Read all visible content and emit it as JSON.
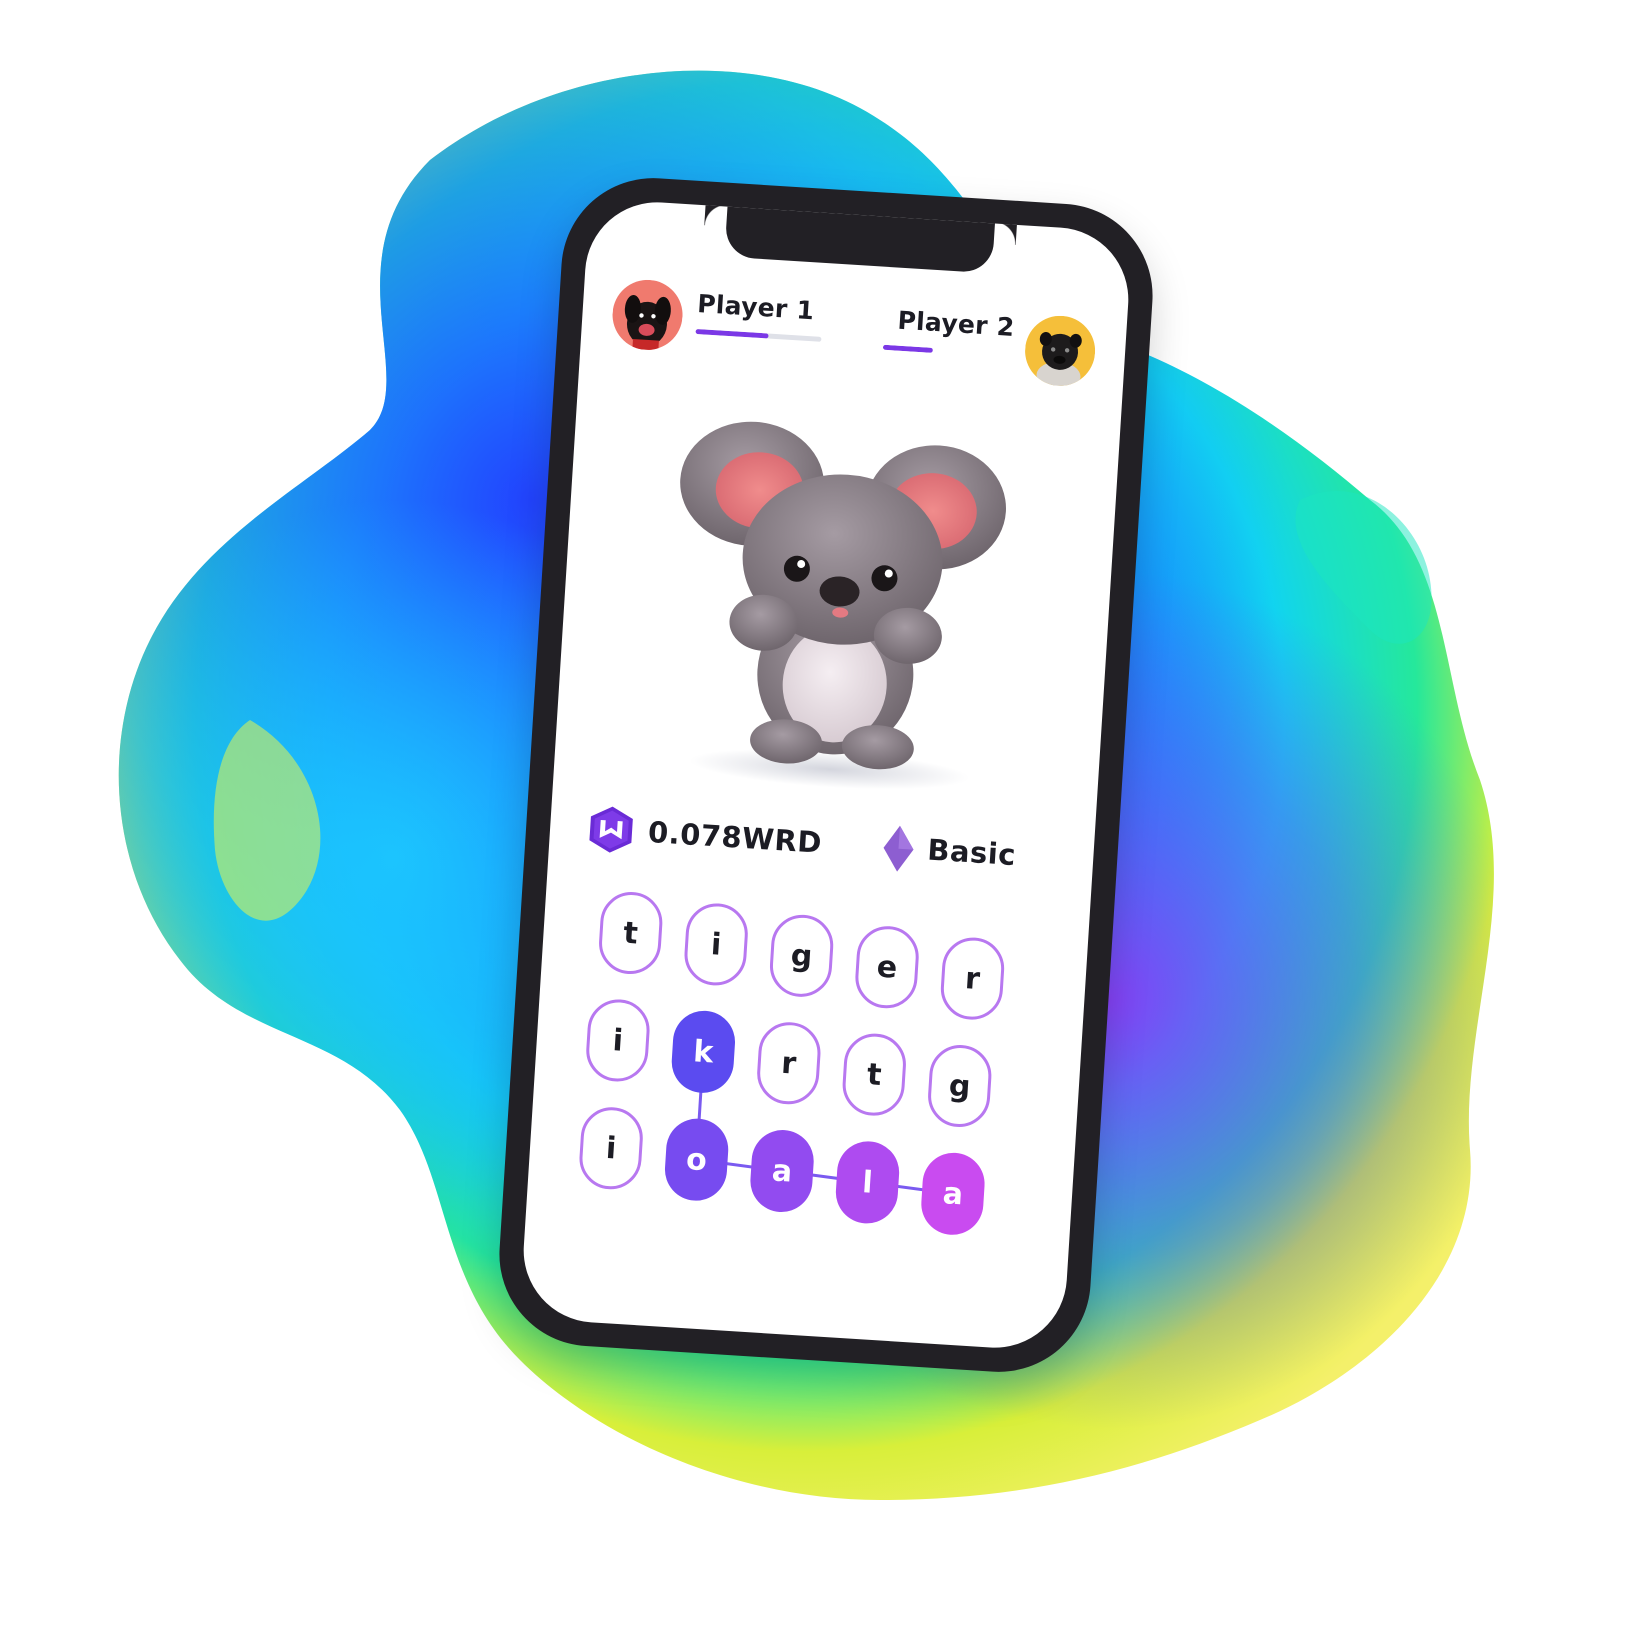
{
  "players": [
    {
      "name": "Player 1",
      "progress": 0.58
    },
    {
      "name": "Player 2",
      "progress": 1.0
    }
  ],
  "token": {
    "value": "0.078WRD",
    "icon": "wrd-token-icon"
  },
  "tier": {
    "label": "Basic",
    "icon": "diamond-icon"
  },
  "colors": {
    "accent": "#7b38e6",
    "tile_border": "#b878f0",
    "phone_frame": "#222025",
    "player1_avatar_bg": "#f07a6e",
    "player2_avatar_bg": "#f5bf3a"
  },
  "mascot": {
    "icon": "koala-icon"
  },
  "grid": {
    "rows": [
      [
        "t",
        "i",
        "g",
        "e",
        "r"
      ],
      [
        "i",
        "k",
        "r",
        "t",
        "g"
      ],
      [
        "i",
        "o",
        "a",
        "l",
        "a"
      ]
    ],
    "selected_path": [
      [
        1,
        1
      ],
      [
        2,
        1
      ],
      [
        2,
        2
      ],
      [
        2,
        3
      ],
      [
        2,
        4
      ]
    ]
  }
}
